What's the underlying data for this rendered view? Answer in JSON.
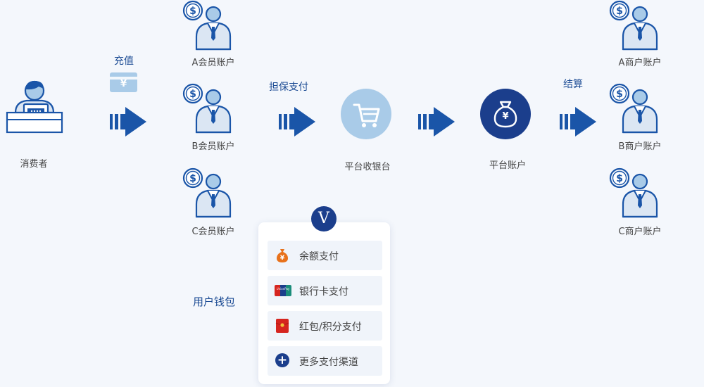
{
  "consumer": {
    "label": "消费者"
  },
  "recharge": {
    "label": "充值",
    "symbol": "¥"
  },
  "members": [
    {
      "label": "A会员账户"
    },
    {
      "label": "B会员账户"
    },
    {
      "label": "C会员账户"
    }
  ],
  "escrow": {
    "label": "担保支付"
  },
  "cashier": {
    "label": "平台收银台"
  },
  "platform": {
    "label": "平台账户",
    "symbol": "¥"
  },
  "settlement": {
    "label": "结算"
  },
  "merchants": [
    {
      "label": "A商户账户"
    },
    {
      "label": "B商户账户"
    },
    {
      "label": "C商户账户"
    }
  ],
  "wallet": {
    "label": "用户钱包",
    "badge": "V",
    "items": [
      {
        "label": "余额支付",
        "icon": "money-bag-icon",
        "symbol": "¥"
      },
      {
        "label": "银行卡支付",
        "icon": "unionpay-card-icon",
        "symbol": "UnionPay"
      },
      {
        "label": "红包/积分支付",
        "icon": "red-envelope-icon"
      },
      {
        "label": "更多支付渠道",
        "icon": "plus-circle-icon",
        "symbol": "+"
      }
    ]
  },
  "colors": {
    "background": "#f4f7fc",
    "primary": "#1a4a93",
    "arrow": "#1a55a8",
    "light_circle": "#a9cbe8",
    "dark_circle": "#1b3e8c",
    "person_outline": "#1a55a8",
    "person_fill": "#a9cbe8"
  }
}
